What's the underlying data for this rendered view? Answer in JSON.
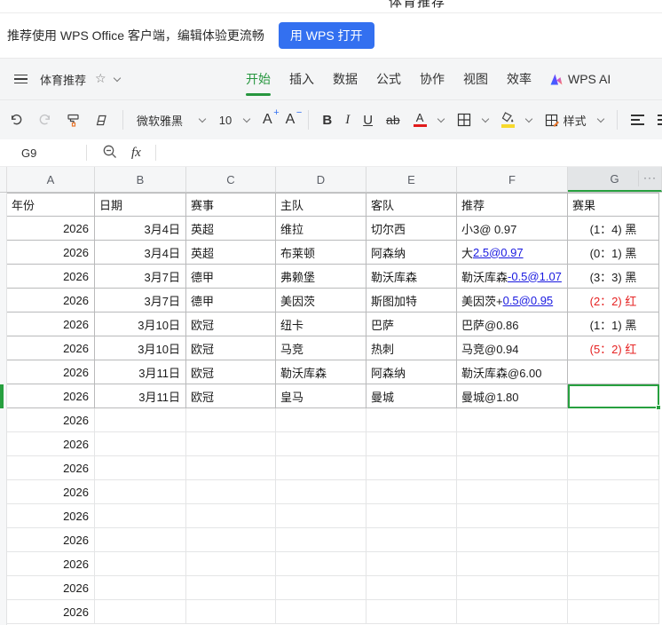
{
  "page_title": "体育推荐",
  "banner": {
    "text": "推荐使用 WPS Office 客户端，编辑体验更流畅",
    "button_label": "用 WPS 打开",
    "button_color": "#3370f0"
  },
  "menu": {
    "doc_title": "体育推荐",
    "tabs": [
      {
        "label": "开始",
        "active": true
      },
      {
        "label": "插入",
        "active": false
      },
      {
        "label": "数据",
        "active": false
      },
      {
        "label": "公式",
        "active": false
      },
      {
        "label": "协作",
        "active": false
      },
      {
        "label": "视图",
        "active": false
      },
      {
        "label": "效率",
        "active": false
      },
      {
        "label": "WPS AI",
        "active": false,
        "logo": true
      }
    ]
  },
  "toolbar": {
    "font_name": "微软雅黑",
    "font_size": "10",
    "bold_label": "B",
    "italic_label": "I",
    "underline_label": "U",
    "strikethrough_label": "ab",
    "font_color_letter": "A",
    "styles_label": "样式",
    "accent_green": "#27963f",
    "font_color_red": "#e11b1b",
    "fill_color_yellow": "#f7d92c"
  },
  "formula_bar": {
    "cell_ref": "G9",
    "formula": ""
  },
  "sheet": {
    "col_letters": [
      "A",
      "B",
      "C",
      "D",
      "E",
      "F",
      "G"
    ],
    "more_cols_indicator": "···",
    "header_row": [
      "年份",
      "日期",
      "赛事",
      "主队",
      "客队",
      "推荐",
      "赛果"
    ],
    "rows": [
      {
        "year": "2026",
        "date": "3月4日",
        "league": "英超",
        "home": "维拉",
        "away": "切尔西",
        "rec_pre": "小3@ 0.97",
        "rec_link": "",
        "result": "(1：4) 黑",
        "result_red": false
      },
      {
        "year": "2026",
        "date": "3月4日",
        "league": "英超",
        "home": "布莱顿",
        "away": "阿森纳",
        "rec_pre": "大",
        "rec_link": "2.5@0.97",
        "result": "(0：1) 黑",
        "result_red": false
      },
      {
        "year": "2026",
        "date": "3月7日",
        "league": "德甲",
        "home": "弗赖堡",
        "away": "勒沃库森",
        "rec_pre": "勒沃库森",
        "rec_link": "-0.5@1.07",
        "result": "(3：3) 黑",
        "result_red": false
      },
      {
        "year": "2026",
        "date": "3月7日",
        "league": "德甲",
        "home": "美因茨",
        "away": "斯图加特",
        "rec_pre": "美因茨+",
        "rec_link": "0.5@0.95",
        "result": "(2：2) 红",
        "result_red": true
      },
      {
        "year": "2026",
        "date": "3月10日",
        "league": "欧冠",
        "home": "纽卡",
        "away": "巴萨",
        "rec_pre": "巴萨@0.86",
        "rec_link": "",
        "result": "(1：1) 黑",
        "result_red": false
      },
      {
        "year": "2026",
        "date": "3月10日",
        "league": "欧冠",
        "home": "马竞",
        "away": "热刺",
        "rec_pre": "马竞@0.94",
        "rec_link": "",
        "result": "(5：2) 红",
        "result_red": true
      },
      {
        "year": "2026",
        "date": "3月11日",
        "league": "欧冠",
        "home": "勒沃库森",
        "away": "阿森纳",
        "rec_pre": "勒沃库森@6.00",
        "rec_link": "",
        "result": "",
        "result_red": false
      },
      {
        "year": "2026",
        "date": "3月11日",
        "league": "欧冠",
        "home": "皇马",
        "away": "曼城",
        "rec_pre": "曼城@1.80",
        "rec_link": "",
        "result": "",
        "result_red": false
      }
    ],
    "empty_row_year": "2026",
    "empty_row_count": 9,
    "selected_cell": "G9",
    "link_color": "#1a1ae0",
    "result_red_color": "#e62222",
    "selection_color": "#27a03f"
  }
}
